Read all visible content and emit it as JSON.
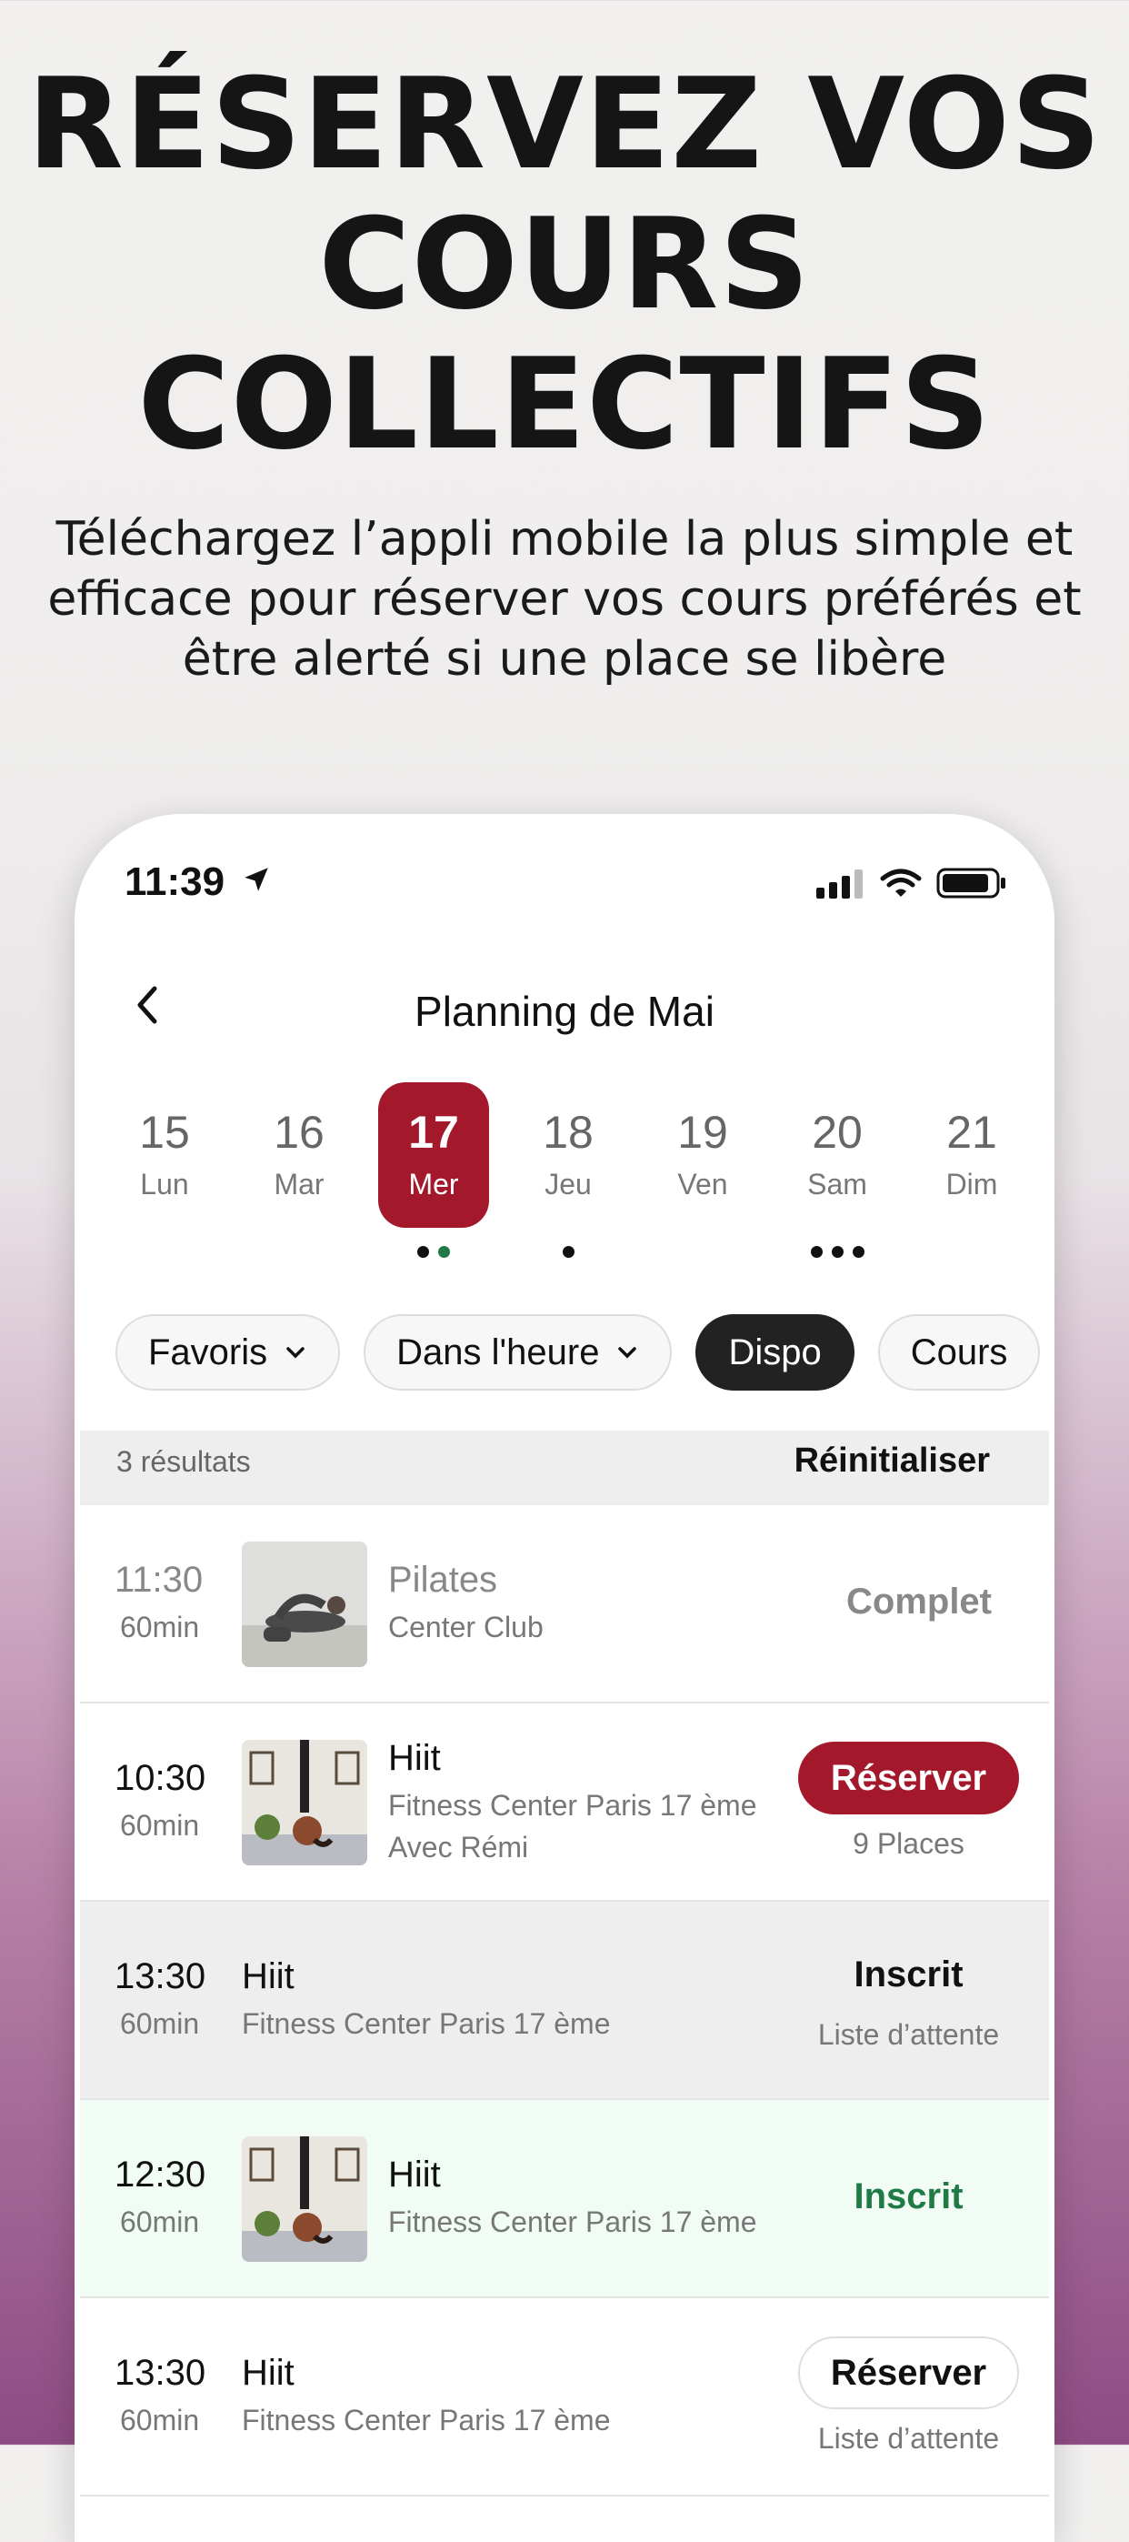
{
  "promo": {
    "headline": [
      "RÉSERVEZ VOS",
      "COURS",
      "COLLECTIFS"
    ],
    "subline": [
      "Téléchargez l’appli mobile la plus simple et",
      "efficace pour réserver vos cours préférés et",
      "être alerté si une place se libère"
    ]
  },
  "status_bar": {
    "time": "11:39"
  },
  "header": {
    "title": "Planning de Mai"
  },
  "days": [
    {
      "num": "15",
      "dow": "Lun"
    },
    {
      "num": "16",
      "dow": "Mar"
    },
    {
      "num": "17",
      "dow": "Mer",
      "selected": true
    },
    {
      "num": "18",
      "dow": "Jeu"
    },
    {
      "num": "19",
      "dow": "Ven"
    },
    {
      "num": "20",
      "dow": "Sam"
    },
    {
      "num": "21",
      "dow": "Dim"
    }
  ],
  "filters": [
    "Favoris",
    "Dans l'heure",
    "Dispo",
    "Cours"
  ],
  "results": {
    "count": "3 résultats",
    "reset": "Réinitialiser"
  },
  "classes": [
    {
      "time": "11:30",
      "duration": "60min",
      "name": "Pilates",
      "location": "Center Club",
      "status": "Complet"
    },
    {
      "time": "10:30",
      "duration": "60min",
      "name": "Hiit",
      "location": "Fitness Center Paris 17 ème",
      "coach": "Avec Rémi",
      "action": "Réserver",
      "places": "9 Places"
    },
    {
      "time": "13:30",
      "duration": "60min",
      "name": "Hiit",
      "location": "Fitness Center Paris 17 ème",
      "status": "Inscrit",
      "note": "Liste d’attente"
    },
    {
      "time": "12:30",
      "duration": "60min",
      "name": "Hiit",
      "location": "Fitness Center Paris 17 ème",
      "status": "Inscrit"
    },
    {
      "time": "13:30",
      "duration": "60min",
      "name": "Hiit",
      "location": "Fitness Center Paris 17 ème",
      "action": "Réserver",
      "note": "Liste d’attente"
    }
  ],
  "colors": {
    "accent": "#a3182b",
    "success": "#1f7a46",
    "dark_chip": "#222222"
  }
}
